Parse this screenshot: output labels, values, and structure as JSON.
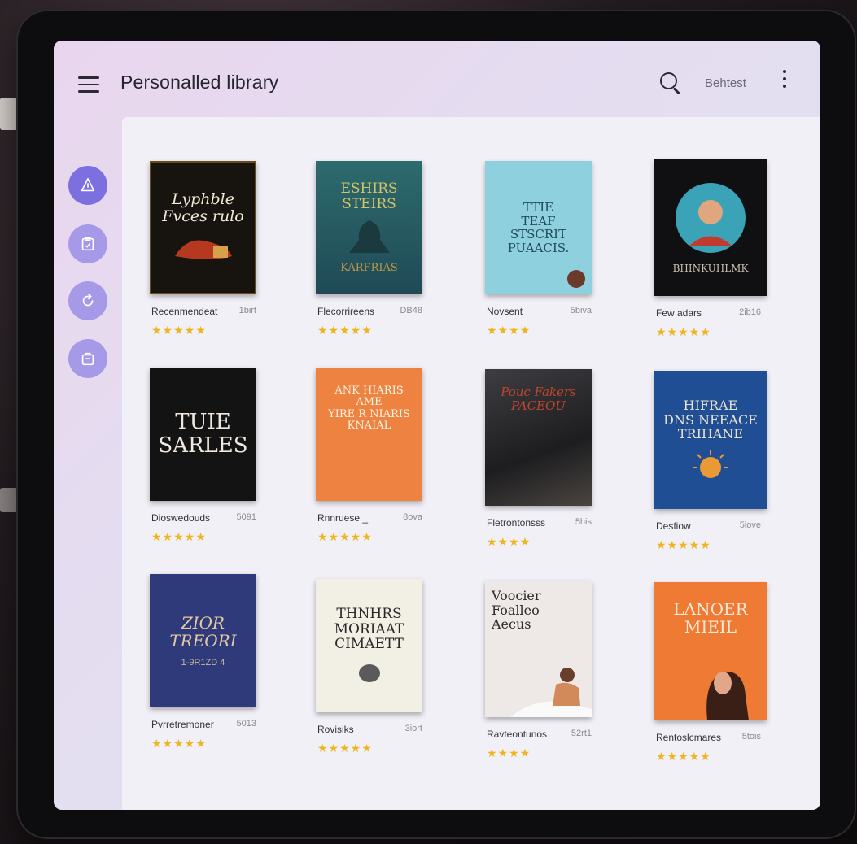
{
  "header": {
    "menu_icon": "hamburger-menu-icon",
    "title": "Personalled library",
    "search_icon": "search-icon",
    "action_label": "Behtest",
    "more_icon": "more-vertical-icon"
  },
  "side_rail": [
    {
      "icon": "triangle-nav-icon",
      "active": true
    },
    {
      "icon": "clipboard-nav-icon",
      "active": false
    },
    {
      "icon": "refresh-nav-icon",
      "active": false
    },
    {
      "icon": "bag-nav-icon",
      "active": false
    }
  ],
  "books": [
    {
      "cover_title": "Lyphble\nFvces rulo",
      "cover_sub": "",
      "name": "Recenmendeat",
      "tag": "1birt",
      "stars": "★★★★★"
    },
    {
      "cover_title": "ESHIRS\nSTEIRS",
      "cover_sub": "KARFRIAS",
      "name": "Flecorrireens",
      "tag": "DB48",
      "stars": "★★★★★"
    },
    {
      "cover_title": "TTIE\nTEAF STSCRIT\nPUAACIS.",
      "cover_sub": "",
      "name": "Novsent",
      "tag": "5biva",
      "stars": "★★★★"
    },
    {
      "cover_title": "",
      "cover_sub": "BHINKUHLMK",
      "name": "Few adars",
      "tag": "2ib16",
      "stars": "★★★★★"
    },
    {
      "cover_title": "TUIE\nSARLES",
      "cover_sub": "",
      "name": "Dioswedouds",
      "tag": "5091",
      "stars": "★★★★★"
    },
    {
      "cover_title": "ANK HIARIS AME\nYIRE R NIARIS\nKNAIAL",
      "cover_sub": "",
      "name": "Rnnruese _",
      "tag": "8ova",
      "stars": "★★★★★"
    },
    {
      "cover_title": "Pouc Fakers\nPACEOU",
      "cover_sub": "",
      "name": "Fletrontonsss",
      "tag": "5his",
      "stars": "★★★★"
    },
    {
      "cover_title": "HIFRAE\nDNS NEEACE\nTRIHANE",
      "cover_sub": "",
      "name": "Desfiow",
      "tag": "5love",
      "stars": "★★★★★"
    },
    {
      "cover_title": "ZIOR\nTREORI",
      "cover_sub": "1-9R1ZD 4",
      "name": "Pvrretremoner",
      "tag": "5013",
      "stars": "★★★★★"
    },
    {
      "cover_title": "THNHRS\nMORIAAT\nCIMAETT",
      "cover_sub": "",
      "name": "Rovisiks",
      "tag": "3iort",
      "stars": "★★★★★"
    },
    {
      "cover_title": "Voocier\nFoalleo\nAecus",
      "cover_sub": "",
      "name": "Ravteontunos",
      "tag": "52rt1",
      "stars": "★★★★"
    },
    {
      "cover_title": "LANOER\nMIEIL",
      "cover_sub": "",
      "name": "Rentoslcmares",
      "tag": "5tois",
      "stars": "★★★★★"
    }
  ],
  "colors": {
    "accent": "#7c6fe0",
    "rail_button": "#a699e8",
    "star": "#efb51e",
    "progress": "#5b6fe6"
  }
}
